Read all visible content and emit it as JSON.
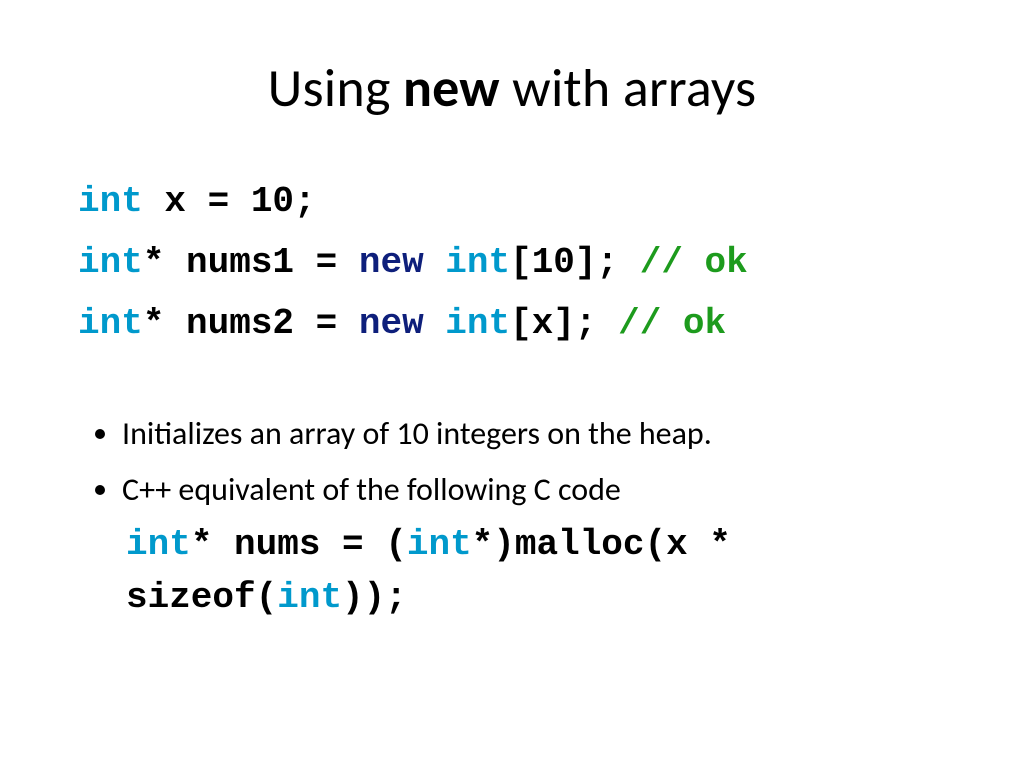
{
  "title": {
    "part1": "Using ",
    "bold": "new",
    "part3": " with arrays"
  },
  "code": {
    "l1_kw": "int",
    "l1_rest": " x = 10;",
    "l2_kw1": "int",
    "l2_mid1": "* nums1 = ",
    "l2_new": "new ",
    "l2_kw2": "int",
    "l2_mid2": "[10];  ",
    "l2_comment": "// ok",
    "l3_kw1": "int",
    "l3_mid1": "* nums2 = ",
    "l3_new": "new ",
    "l3_kw2": "int",
    "l3_mid2": "[x];   ",
    "l3_comment": "// ok"
  },
  "bullets": {
    "b1": "Initializes an array of 10 integers on the heap.",
    "b2": "C++ equivalent of the following C code"
  },
  "inline_code": {
    "p1_kw": "int",
    "p1_rest": "* nums = (",
    "p2_kw": "int",
    "p2_rest": "*)malloc(x * sizeof(",
    "p3_kw": "int",
    "p3_rest": "));"
  }
}
